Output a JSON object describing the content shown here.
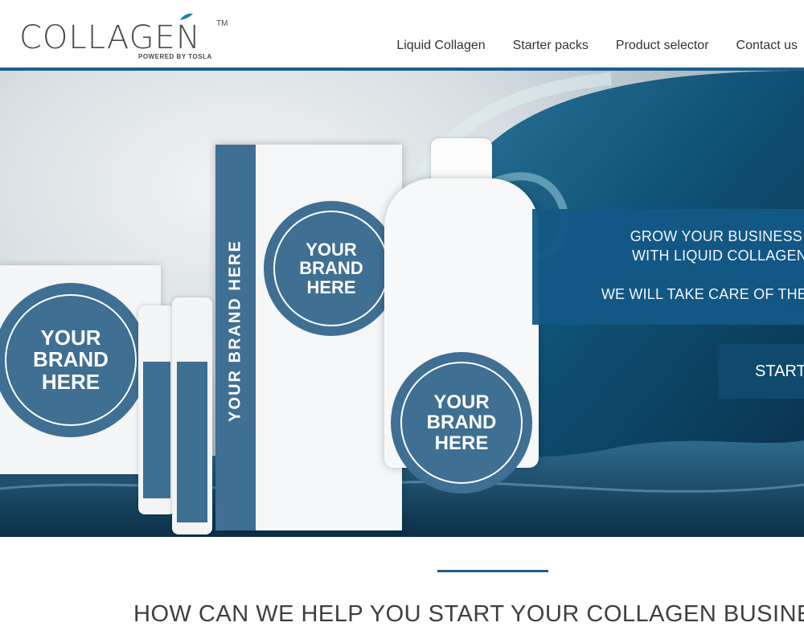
{
  "logo": {
    "word": "COLLAGEN",
    "tm": "TM",
    "sub": "POWERED BY TOSLA"
  },
  "nav": {
    "items": [
      "Liquid Collagen",
      "Starter packs",
      "Product selector",
      "Contact us"
    ]
  },
  "hero": {
    "line1": "GROW YOUR BUSINESS",
    "line2": "WITH LIQUID COLLAGEN",
    "line3": "WE WILL TAKE CARE OF THE",
    "cta": "START",
    "brand_label": "YOUR BRAND HERE",
    "brand_word1": "YOUR",
    "brand_word2": "BRAND",
    "brand_word3": "HERE"
  },
  "section": {
    "title": "HOW CAN WE HELP YOU START YOUR COLLAGEN BUSINE"
  },
  "colors": {
    "brand_blue": "#1d5e8b",
    "label_blue": "#3f6f93",
    "panel_blue": "#135987"
  }
}
